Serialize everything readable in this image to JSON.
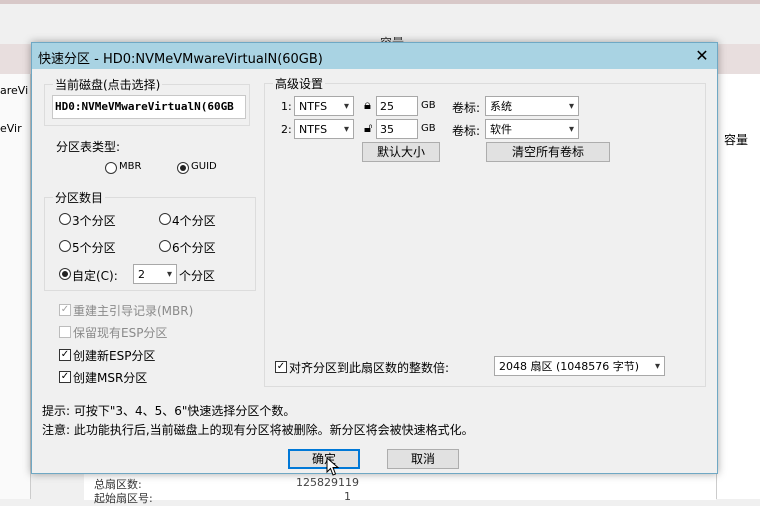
{
  "background": {
    "header_title": "容量",
    "left_text_1": "areVi",
    "left_text_2": "eVir",
    "column_capacity": "容量",
    "bottom_label_1": "总扇区数:",
    "bottom_value_1": "125829119",
    "bottom_label_2": "起始扇区号:",
    "bottom_value_2": "1"
  },
  "dialog": {
    "title": "快速分区 - HD0:NVMeVMwareVirtualN(60GB)",
    "close_symbol": "✕",
    "current_disk": {
      "legend": "当前磁盘(点击选择)",
      "value": "HD0:NVMeVMwareVirtualN(60GB"
    },
    "partition_table": {
      "label": "分区表类型:",
      "options": [
        "MBR",
        "GUID"
      ],
      "selected": "GUID"
    },
    "partition_count": {
      "legend": "分区数目",
      "options": [
        "3个分区",
        "4个分区",
        "5个分区",
        "6个分区"
      ],
      "custom_label": "自定(C):",
      "custom_value": "2",
      "custom_suffix": "个分区",
      "selected": "自定"
    },
    "checkboxes": [
      {
        "label": "重建主引导记录(MBR)",
        "checked": true,
        "disabled": true
      },
      {
        "label": "保留现有ESP分区",
        "checked": false,
        "disabled": true
      },
      {
        "label": "创建新ESP分区",
        "checked": true,
        "disabled": false
      },
      {
        "label": "创建MSR分区",
        "checked": true,
        "disabled": false
      }
    ],
    "advanced": {
      "legend": "高级设置",
      "rows": [
        {
          "index": "1:",
          "fs": "NTFS",
          "size": "25",
          "unit": "GB",
          "label_caption": "卷标:",
          "label_value": "系统",
          "lock": "locked"
        },
        {
          "index": "2:",
          "fs": "NTFS",
          "size": "35",
          "unit": "GB",
          "label_caption": "卷标:",
          "label_value": "软件",
          "lock": "unlocked"
        }
      ],
      "default_size_button": "默认大小",
      "clear_labels_button": "清空所有卷标",
      "align_label": "对齐分区到此扇区数的整数倍:",
      "align_checked": true,
      "align_value": "2048 扇区 (1048576 字节)"
    },
    "hint": "提示: 可按下\"3、4、5、6\"快速选择分区个数。",
    "note": "注意: 此功能执行后,当前磁盘上的现有分区将被删除。新分区将会被快速格式化。",
    "ok_button": "确定",
    "cancel_button": "取消"
  }
}
